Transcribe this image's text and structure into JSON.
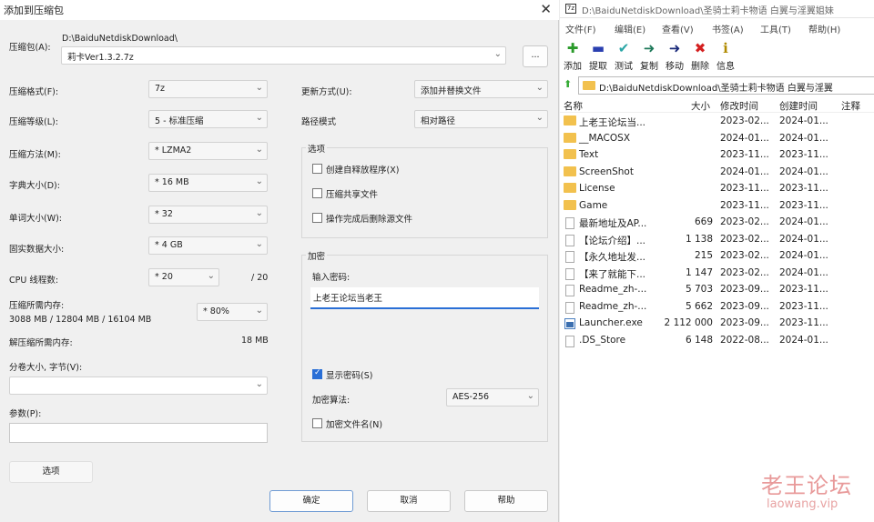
{
  "dialog": {
    "title": "添加到压缩包",
    "archive_label": "压缩包(A):",
    "archive_dir": "D:\\BaiduNetdiskDownload\\",
    "archive_name": "莉卡Ver1.3.2.7z",
    "browse_label": "...",
    "format_label": "压缩格式(F):",
    "format_value": "7z",
    "level_label": "压缩等级(L):",
    "level_value": "5 - 标准压缩",
    "method_label": "压缩方法(M):",
    "method_value": "* LZMA2",
    "dict_label": "字典大小(D):",
    "dict_value": "* 16 MB",
    "word_label": "单词大小(W):",
    "word_value": "* 32",
    "solid_label": "固实数据大小:",
    "solid_value": "* 4 GB",
    "cpu_label": "CPU 线程数:",
    "cpu_value": "* 20",
    "cpu_total": "/ 20",
    "mem_label": "压缩所需内存:",
    "mem_values": "3088 MB / 12804 MB / 16104 MB",
    "mem_percent": "* 80%",
    "decomp_label": "解压缩所需内存:",
    "decomp_value": "18 MB",
    "split_label": "分卷大小, 字节(V):",
    "split_value": "",
    "params_label": "参数(P):",
    "params_value": "",
    "options_btn": "选项",
    "update_label": "更新方式(U):",
    "update_value": "添加并替换文件",
    "path_label": "路径模式",
    "path_value": "相对路径",
    "options_group": "选项",
    "opt_sfx": "创建自释放程序(X)",
    "opt_shared": "压缩共享文件",
    "opt_delete": "操作完成后删除源文件",
    "encrypt_group": "加密",
    "password_label": "输入密码:",
    "password_value": "上老王论坛当老王",
    "show_password": "显示密码(S)",
    "enc_method_label": "加密算法:",
    "enc_method_value": "AES-256",
    "encrypt_names": "加密文件名(N)",
    "ok": "确定",
    "cancel": "取消",
    "help": "帮助"
  },
  "fm": {
    "title": "D:\\BaiduNetdiskDownload\\圣骑士莉卡物语 白翼与淫翼姐妹",
    "menu": [
      "文件(F)",
      "编辑(E)",
      "查看(V)",
      "书签(A)",
      "工具(T)",
      "帮助(H)"
    ],
    "tools": [
      {
        "icon": "plus-icon",
        "label": "添加",
        "glyph": "✚",
        "color": "#2a9a2a"
      },
      {
        "icon": "minus-icon",
        "label": "提取",
        "glyph": "▬",
        "color": "#2a3fb0"
      },
      {
        "icon": "check-icon",
        "label": "测试",
        "glyph": "✔",
        "color": "#2aa6a6"
      },
      {
        "icon": "copy-arrow-icon",
        "label": "复制",
        "glyph": "➜",
        "color": "#1f7a5a"
      },
      {
        "icon": "move-arrow-icon",
        "label": "移动",
        "glyph": "➜",
        "color": "#1a2a7a"
      },
      {
        "icon": "delete-x-icon",
        "label": "删除",
        "glyph": "✖",
        "color": "#d42020"
      },
      {
        "icon": "info-icon",
        "label": "信息",
        "glyph": "ℹ",
        "color": "#b08a00"
      }
    ],
    "address": "D:\\BaiduNetdiskDownload\\圣骑士莉卡物语 白翼与淫翼",
    "columns": {
      "name": "名称",
      "size": "大小",
      "modified": "修改时间",
      "created": "创建时间",
      "comment": "注释"
    },
    "rows": [
      {
        "type": "folder",
        "name": "上老王论坛当...",
        "size": "",
        "modified": "2023-02...",
        "created": "2024-01..."
      },
      {
        "type": "folder",
        "name": "__MACOSX",
        "size": "",
        "modified": "2024-01...",
        "created": "2024-01..."
      },
      {
        "type": "folder",
        "name": "Text",
        "size": "",
        "modified": "2023-11...",
        "created": "2023-11..."
      },
      {
        "type": "folder",
        "name": "ScreenShot",
        "size": "",
        "modified": "2024-01...",
        "created": "2024-01..."
      },
      {
        "type": "folder",
        "name": "License",
        "size": "",
        "modified": "2023-11...",
        "created": "2023-11..."
      },
      {
        "type": "folder",
        "name": "Game",
        "size": "",
        "modified": "2023-11...",
        "created": "2023-11..."
      },
      {
        "type": "file",
        "name": "最新地址及AP...",
        "size": "669",
        "modified": "2023-02...",
        "created": "2024-01..."
      },
      {
        "type": "file",
        "name": "【论坛介绍】...",
        "size": "1 138",
        "modified": "2023-02...",
        "created": "2024-01..."
      },
      {
        "type": "file",
        "name": "【永久地址发...",
        "size": "215",
        "modified": "2023-02...",
        "created": "2024-01..."
      },
      {
        "type": "file",
        "name": "【来了就能下...",
        "size": "1 147",
        "modified": "2023-02...",
        "created": "2024-01..."
      },
      {
        "type": "file",
        "name": "Readme_zh-...",
        "size": "5 703",
        "modified": "2023-09...",
        "created": "2023-11..."
      },
      {
        "type": "file",
        "name": "Readme_zh-...",
        "size": "5 662",
        "modified": "2023-09...",
        "created": "2023-11..."
      },
      {
        "type": "exe",
        "name": "Launcher.exe",
        "size": "2 112 000",
        "modified": "2023-09...",
        "created": "2023-11..."
      },
      {
        "type": "file",
        "name": ".DS_Store",
        "size": "6 148",
        "modified": "2022-08...",
        "created": "2024-01..."
      }
    ]
  },
  "watermark": {
    "text1": "老王论坛",
    "text2": "laowang.vip"
  }
}
